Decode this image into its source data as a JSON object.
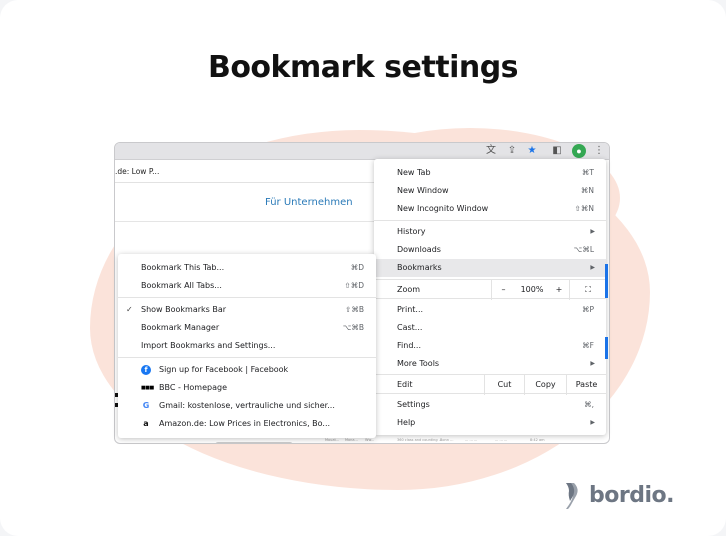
{
  "title": "Bookmark settings",
  "page": {
    "tab_text": ".de: Low P...",
    "page_button": "Für Unternehmen",
    "bottom_bits": [
      "Mouat...",
      "Mona...",
      "Ww...",
      "360 class and counting ...",
      "Bonn ...",
      "... ... ...",
      "... ... ...",
      "8:42 am"
    ]
  },
  "toolbar_icons": [
    "translate-icon",
    "share-icon",
    "star-icon",
    "sidebar-icon",
    "profile-icon",
    "more-icon"
  ],
  "main_menu": {
    "items": [
      {
        "label": "New Tab",
        "shortcut": "⌘T"
      },
      {
        "label": "New Window",
        "shortcut": "⌘N"
      },
      {
        "label": "New Incognito Window",
        "shortcut": "⇧⌘N"
      },
      {
        "label": "History",
        "shortcut": "▶"
      },
      {
        "label": "Downloads",
        "shortcut": "⌥⌘L"
      },
      {
        "label": "Bookmarks",
        "shortcut": "▶"
      }
    ],
    "zoom": {
      "label": "Zoom",
      "minus": "–",
      "value": "100%",
      "plus": "+",
      "fullscreen": "⛶"
    },
    "items2": [
      {
        "label": "Print...",
        "shortcut": "⌘P"
      },
      {
        "label": "Cast..."
      },
      {
        "label": "Find...",
        "shortcut": "⌘F"
      },
      {
        "label": "More Tools",
        "shortcut": "▶"
      }
    ],
    "edit": {
      "label": "Edit",
      "cut": "Cut",
      "copy": "Copy",
      "paste": "Paste"
    },
    "items3": [
      {
        "label": "Settings",
        "shortcut": "⌘,"
      },
      {
        "label": "Help",
        "shortcut": "▶"
      }
    ]
  },
  "bookmarks_menu": {
    "items": [
      {
        "label": "Bookmark This Tab...",
        "shortcut": "⌘D"
      },
      {
        "label": "Bookmark All Tabs...",
        "shortcut": "⇧⌘D"
      },
      {
        "label": "Show Bookmarks Bar",
        "shortcut": "⇧⌘B",
        "checked": "✓"
      },
      {
        "label": "Bookmark Manager",
        "shortcut": "⌥⌘B"
      },
      {
        "label": "Import Bookmarks and Settings..."
      }
    ],
    "bookmarks": [
      {
        "label": "Sign up for Facebook | Facebook",
        "icon": "f"
      },
      {
        "label": "BBC - Homepage",
        "icon": "■■■"
      },
      {
        "label": "Gmail: kostenlose, vertrauliche und sicher...",
        "icon": "G"
      },
      {
        "label": "Amazon.de: Low Prices in Electronics, Bo...",
        "icon": "a"
      }
    ]
  },
  "brand": {
    "name": "bordio.",
    "accent": "#1a73e8",
    "blob": "#fbe3da"
  }
}
